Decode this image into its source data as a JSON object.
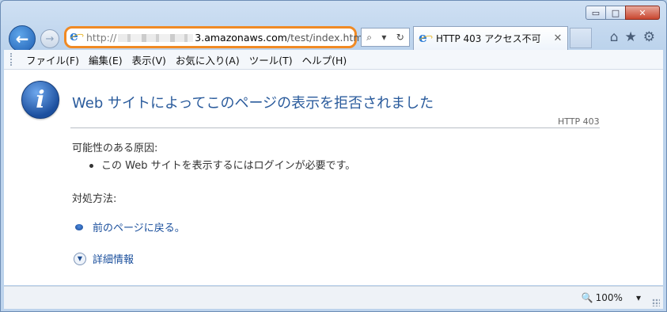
{
  "window": {
    "controls": {
      "minimize": "▭",
      "maximize": "□",
      "close": "✕"
    }
  },
  "nav": {
    "back_icon": "back-arrow-icon",
    "forward_icon": "forward-arrow-icon"
  },
  "address_bar": {
    "protocol": "http://",
    "domain_visible": "3.amazonaws.com",
    "path": "/test/index.html",
    "highlight_color": "#f08a24"
  },
  "address_tools": {
    "search": "⌕",
    "dropdown": "▾",
    "refresh": "↻"
  },
  "tab": {
    "title": "HTTP 403 アクセス不可",
    "close": "✕"
  },
  "toolbar_icons": {
    "home": "⌂",
    "favorites": "★",
    "settings": "⚙"
  },
  "menu": {
    "items": [
      "ファイル(F)",
      "編集(E)",
      "表示(V)",
      "お気に入り(A)",
      "ツール(T)",
      "ヘルプ(H)"
    ]
  },
  "page": {
    "title": "Web サイトによってこのページの表示を拒否されました",
    "http_code": "HTTP 403",
    "cause_heading": "可能性のある原因:",
    "causes": [
      "この Web サイトを表示するにはログインが必要です。"
    ],
    "action_heading": "対処方法:",
    "back_link": "前のページに戻る。",
    "details_link": "詳細情報",
    "title_color": "#2a5b9c",
    "link_color": "#1a4f9c"
  },
  "status_bar": {
    "zoom": "100%",
    "zoom_caret": "▾"
  }
}
